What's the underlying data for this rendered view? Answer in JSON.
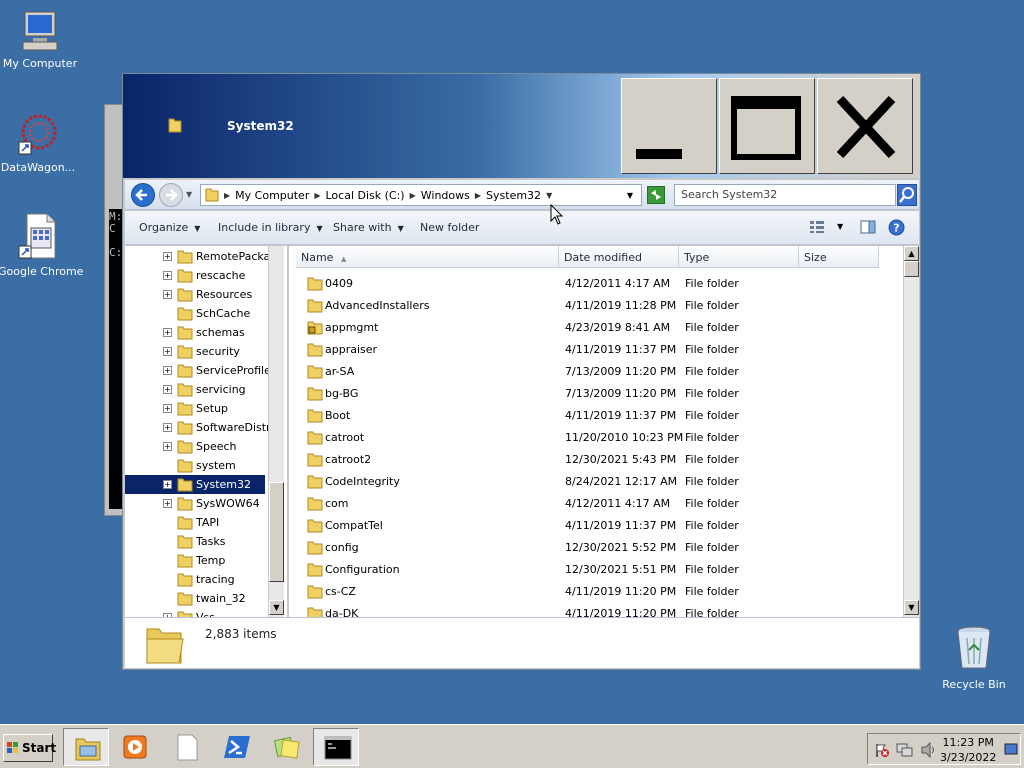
{
  "desktop": {
    "icons": [
      {
        "label": "My Computer"
      },
      {
        "label": "DataWagon..."
      },
      {
        "label": "Google Chrome"
      }
    ],
    "recycle_bin": "Recycle Bin"
  },
  "console": {
    "lines": [
      "M:",
      "C",
      "C:"
    ]
  },
  "window": {
    "title": "System32",
    "address": {
      "crumbs": [
        "My Computer",
        "Local Disk (C:)",
        "Windows",
        "System32"
      ],
      "search_placeholder": "Search System32"
    },
    "toolbar": {
      "organize": "Organize",
      "include_in_library": "Include in library",
      "share_with": "Share with",
      "new_folder": "New folder"
    },
    "tree": [
      {
        "label": "RemotePackag",
        "expand": true
      },
      {
        "label": "rescache",
        "expand": true
      },
      {
        "label": "Resources",
        "expand": true
      },
      {
        "label": "SchCache",
        "expand": false
      },
      {
        "label": "schemas",
        "expand": true
      },
      {
        "label": "security",
        "expand": true
      },
      {
        "label": "ServiceProfiles",
        "expand": true
      },
      {
        "label": "servicing",
        "expand": true
      },
      {
        "label": "Setup",
        "expand": true
      },
      {
        "label": "SoftwareDistrib",
        "expand": true
      },
      {
        "label": "Speech",
        "expand": true
      },
      {
        "label": "system",
        "expand": false
      },
      {
        "label": "System32",
        "expand": true,
        "selected": true
      },
      {
        "label": "SysWOW64",
        "expand": true
      },
      {
        "label": "TAPI",
        "expand": false
      },
      {
        "label": "Tasks",
        "expand": false
      },
      {
        "label": "Temp",
        "expand": false
      },
      {
        "label": "tracing",
        "expand": false
      },
      {
        "label": "twain_32",
        "expand": false
      },
      {
        "label": "Vss",
        "expand": true
      }
    ],
    "columns": {
      "name": "Name",
      "date": "Date modified",
      "type": "Type",
      "size": "Size"
    },
    "files": [
      {
        "name": "0409",
        "date": "4/12/2011 4:17 AM",
        "type": "File folder"
      },
      {
        "name": "AdvancedInstallers",
        "date": "4/11/2019 11:28 PM",
        "type": "File folder"
      },
      {
        "name": "appmgmt",
        "date": "4/23/2019 8:41 AM",
        "type": "File folder",
        "locked": true
      },
      {
        "name": "appraiser",
        "date": "4/11/2019 11:37 PM",
        "type": "File folder"
      },
      {
        "name": "ar-SA",
        "date": "7/13/2009 11:20 PM",
        "type": "File folder"
      },
      {
        "name": "bg-BG",
        "date": "7/13/2009 11:20 PM",
        "type": "File folder"
      },
      {
        "name": "Boot",
        "date": "4/11/2019 11:37 PM",
        "type": "File folder"
      },
      {
        "name": "catroot",
        "date": "11/20/2010 10:23 PM",
        "type": "File folder"
      },
      {
        "name": "catroot2",
        "date": "12/30/2021 5:43 PM",
        "type": "File folder"
      },
      {
        "name": "CodeIntegrity",
        "date": "8/24/2021 12:17 AM",
        "type": "File folder"
      },
      {
        "name": "com",
        "date": "4/12/2011 4:17 AM",
        "type": "File folder"
      },
      {
        "name": "CompatTel",
        "date": "4/11/2019 11:37 PM",
        "type": "File folder"
      },
      {
        "name": "config",
        "date": "12/30/2021 5:52 PM",
        "type": "File folder"
      },
      {
        "name": "Configuration",
        "date": "12/30/2021 5:51 PM",
        "type": "File folder"
      },
      {
        "name": "cs-CZ",
        "date": "4/11/2019 11:20 PM",
        "type": "File folder"
      },
      {
        "name": "da-DK",
        "date": "4/11/2019 11:20 PM",
        "type": "File folder"
      }
    ],
    "status": {
      "item_count": "2,883 items"
    }
  },
  "taskbar": {
    "start": "Start",
    "clock": {
      "time": "11:23 PM",
      "date": "3/23/2022"
    }
  }
}
